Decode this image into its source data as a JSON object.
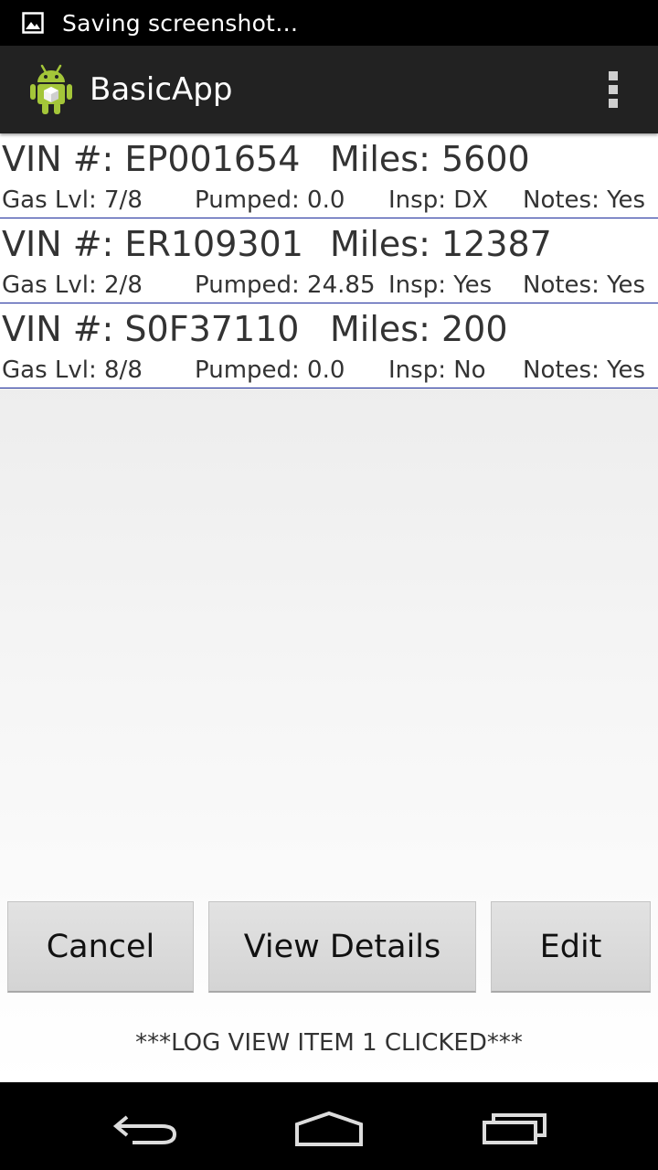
{
  "status_bar": {
    "icon": "image-icon",
    "text": "Saving screenshot…"
  },
  "action_bar": {
    "app_icon": "android-robot-icon",
    "title": "BasicApp",
    "overflow_icon": "overflow-menu-icon"
  },
  "vehicles": [
    {
      "vin": "VIN #: EP001654",
      "miles": "Miles: 5600",
      "gas": "Gas Lvl: 7/8",
      "pumped": "Pumped: 0.0",
      "insp": "Insp: DX",
      "notes": "Notes: Yes"
    },
    {
      "vin": "VIN #: ER109301",
      "miles": "Miles: 12387",
      "gas": "Gas Lvl: 2/8",
      "pumped": "Pumped: 24.85",
      "insp": "Insp: Yes",
      "notes": "Notes: Yes"
    },
    {
      "vin": "VIN #: S0F37110",
      "miles": "Miles: 200",
      "gas": "Gas Lvl: 8/8",
      "pumped": "Pumped: 0.0",
      "insp": "Insp: No",
      "notes": "Notes: Yes"
    }
  ],
  "buttons": {
    "cancel": "Cancel",
    "view_details": "View Details",
    "edit": "Edit"
  },
  "log_message": "***LOG VIEW ITEM 1 CLICKED***",
  "nav_bar": {
    "back_icon": "back-icon",
    "home_icon": "home-icon",
    "recents_icon": "recents-icon"
  },
  "colors": {
    "action_bar": "#222222",
    "row_divider": "#1a2a9a",
    "android_green": "#a4c639"
  }
}
